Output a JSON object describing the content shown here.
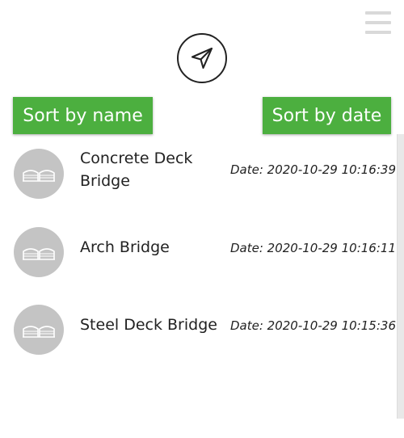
{
  "menu": {
    "icon": "hamburger-menu-icon"
  },
  "navigation": {
    "icon": "send-arrow-icon"
  },
  "sort": {
    "by_name_label": "Sort by name",
    "by_date_label": "Sort by date",
    "accent_color": "#4caf3f"
  },
  "items": [
    {
      "name_line1": "Concrete Deck",
      "name_line2": "Bridge",
      "date": "Date: 2020-10-29 10:16:39",
      "icon": "bridge-icon"
    },
    {
      "name_line1": "Arch Bridge",
      "name_line2": "",
      "date": "Date: 2020-10-29 10:16:11",
      "icon": "bridge-icon"
    },
    {
      "name_line1": "Steel Deck Bridge",
      "name_line2": "",
      "date": "Date: 2020-10-29 10:15:36",
      "icon": "bridge-icon"
    }
  ]
}
